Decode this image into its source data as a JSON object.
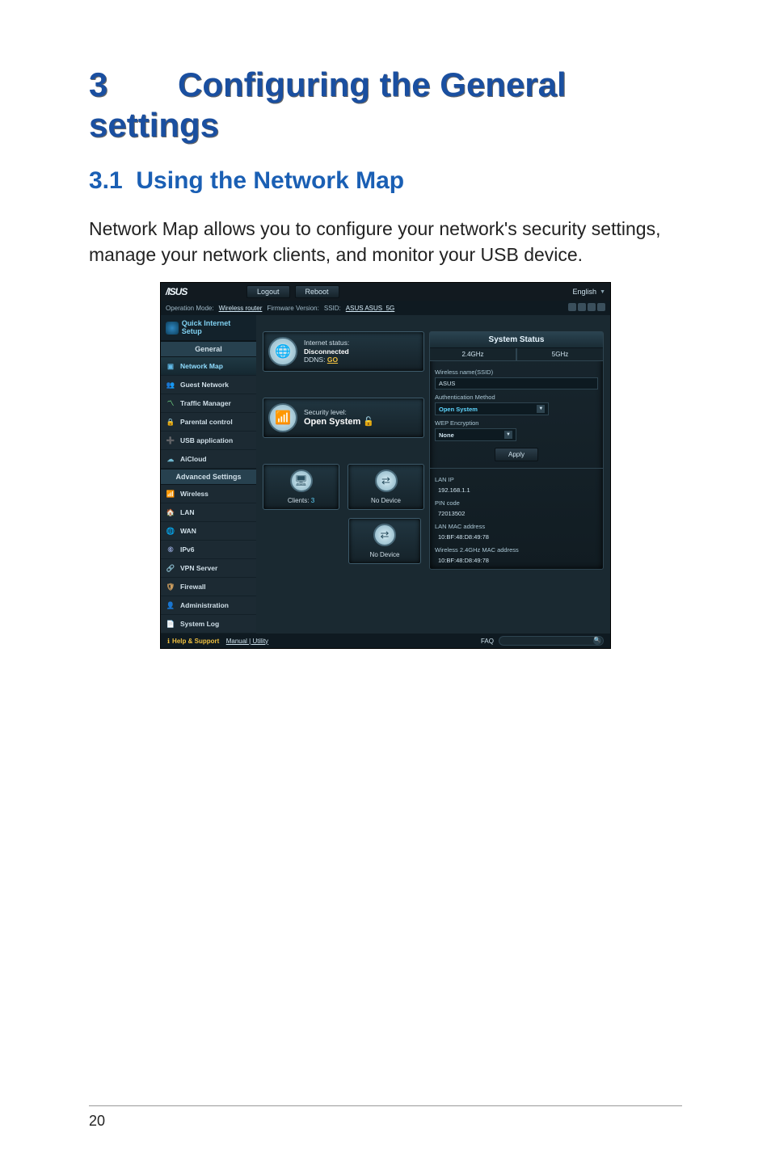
{
  "doc": {
    "chapter_number": "3",
    "chapter_title": "Configuring the General settings",
    "section_number": "3.1",
    "section_title": "Using the Network Map",
    "paragraph": "Network Map allows you to configure your network's security settings, manage your network clients, and monitor your USB device.",
    "page_number": "20"
  },
  "shot": {
    "brand": "/ISUS",
    "buttons": {
      "logout": "Logout",
      "reboot": "Reboot"
    },
    "language": "English",
    "infobar": {
      "op_mode_label": "Operation Mode:",
      "op_mode_value": "Wireless router",
      "fw_label": "Firmware Version:",
      "ssid_label": "SSID:",
      "ssid_value": "ASUS  ASUS_5G"
    },
    "sidebar": {
      "qis": "Quick Internet Setup",
      "general_header": "General",
      "general": [
        {
          "icon": "network-map-icon",
          "label": "Network Map",
          "active": true
        },
        {
          "icon": "guest-network-icon",
          "label": "Guest Network",
          "active": false
        },
        {
          "icon": "traffic-manager-icon",
          "label": "Traffic Manager",
          "active": false
        },
        {
          "icon": "parental-control-icon",
          "label": "Parental control",
          "active": false
        },
        {
          "icon": "usb-application-icon",
          "label": "USB application",
          "active": false
        },
        {
          "icon": "aicloud-icon",
          "label": "AiCloud",
          "active": false
        }
      ],
      "advanced_header": "Advanced Settings",
      "advanced": [
        {
          "icon": "wireless-icon",
          "label": "Wireless"
        },
        {
          "icon": "lan-icon",
          "label": "LAN"
        },
        {
          "icon": "wan-icon",
          "label": "WAN"
        },
        {
          "icon": "ipv6-icon",
          "label": "IPv6"
        },
        {
          "icon": "vpn-server-icon",
          "label": "VPN Server"
        },
        {
          "icon": "firewall-icon",
          "label": "Firewall"
        },
        {
          "icon": "administration-icon",
          "label": "Administration"
        },
        {
          "icon": "system-log-icon",
          "label": "System Log"
        }
      ]
    },
    "cards": {
      "internet": {
        "status_label": "Internet status:",
        "status_value": "Disconnected",
        "ddns_label": "DDNS:",
        "ddns_value": "GO"
      },
      "security": {
        "label": "Security level:",
        "value": "Open System"
      },
      "clients": {
        "label": "Clients:",
        "value": "3"
      },
      "usb1": {
        "label": "No Device"
      },
      "usb2": {
        "label": "No Device"
      }
    },
    "status_panel": {
      "title": "System Status",
      "tabs": {
        "t1": "2.4GHz",
        "t2": "5GHz"
      },
      "fields": {
        "ssid_label": "Wireless name(SSID)",
        "ssid_value": "ASUS",
        "auth_label": "Authentication Method",
        "auth_value": "Open System",
        "wep_label": "WEP Encryption",
        "wep_value": "None",
        "apply": "Apply",
        "lanip_label": "LAN IP",
        "lanip_value": "192.168.1.1",
        "pin_label": "PIN code",
        "pin_value": "72013502",
        "lanmac_label": "LAN MAC address",
        "lanmac_value": "10:BF:48:D8:49:78",
        "wmac_label": "Wireless 2.4GHz MAC address",
        "wmac_value": "10:BF:48:D8:49:78"
      }
    },
    "bottom": {
      "help": "Help & Support",
      "links": "Manual | Utility",
      "faq": "FAQ"
    }
  }
}
